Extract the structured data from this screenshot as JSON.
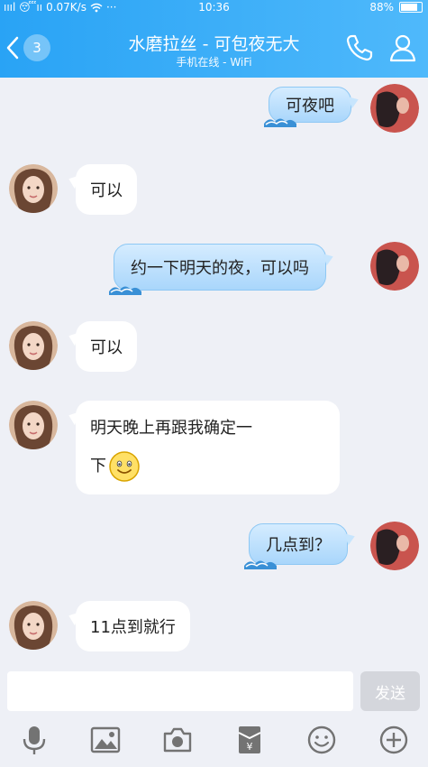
{
  "status_bar": {
    "carrier": "ıııl 😴ıı",
    "speed": "0.07K/s",
    "more": "···",
    "time": "10:36",
    "battery": "88%",
    "battery_level": 0.88
  },
  "header": {
    "back_badge": "3",
    "title": "水磨拉丝 - 可包夜无大",
    "subtitle": "手机在线 - WiFi",
    "icons": [
      "phone-icon",
      "profile-icon"
    ]
  },
  "messages": [
    {
      "side": "right",
      "text": "可夜吧"
    },
    {
      "side": "left",
      "text": "可以"
    },
    {
      "side": "right",
      "text": "约一下明天的夜，可以吗"
    },
    {
      "side": "left",
      "text": "可以"
    },
    {
      "side": "left",
      "line1": "明天晚上再跟我确定一",
      "line2": "下",
      "emoji": "smiley-emoji"
    },
    {
      "side": "right",
      "text": "几点到？"
    },
    {
      "side": "left",
      "text": "11点到就行"
    }
  ],
  "input": {
    "value": "",
    "send_label": "发送"
  },
  "toolbar": [
    "microphone-icon",
    "image-icon",
    "camera-icon",
    "red-packet-icon",
    "emoji-icon",
    "plus-icon"
  ],
  "colors": {
    "header_start": "#29a3f5",
    "header_end": "#4fb9fb",
    "background": "#eef0f6",
    "bubble_right": "#bfe2fd"
  }
}
